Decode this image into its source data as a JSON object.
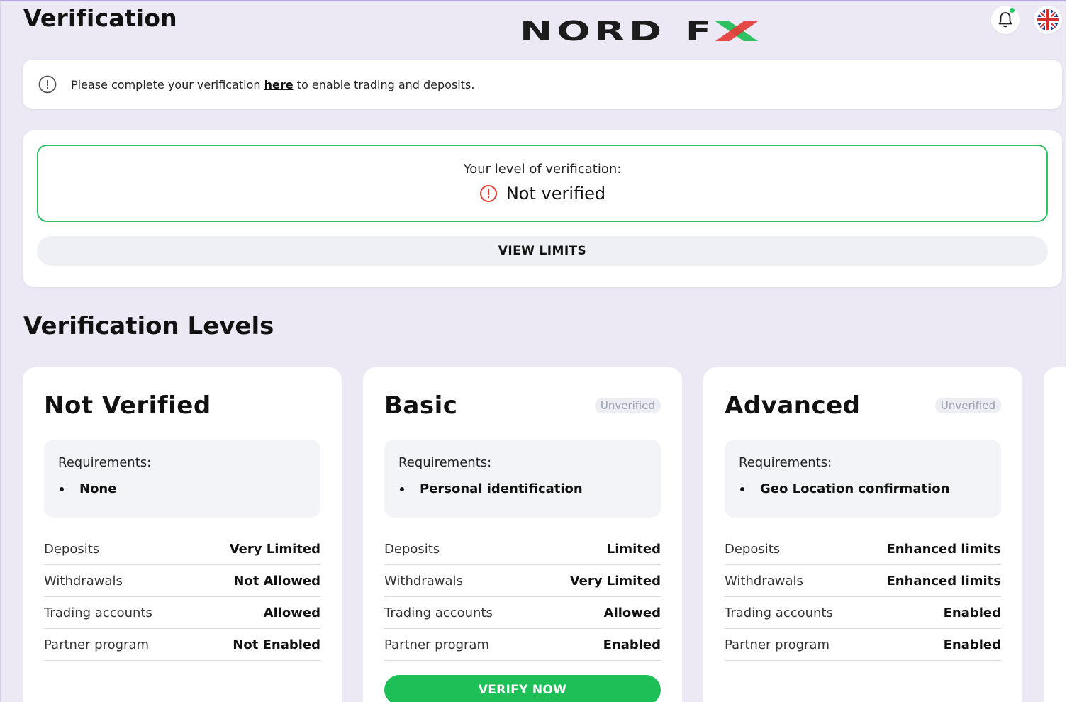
{
  "header": {
    "title": "Verification",
    "logo_text_1": "NORD",
    "logo_text_2": "FX"
  },
  "notice": {
    "before": "Please complete your verification ",
    "link": "here",
    "after": " to enable trading and deposits."
  },
  "current_level": {
    "label": "Your level of verification:",
    "status": "Not verified",
    "button": "VIEW LIMITS"
  },
  "levels_section": {
    "title": "Verification Levels"
  },
  "tiers": [
    {
      "name": "Not Verified",
      "badge": "",
      "requirements_title": "Requirements:",
      "requirement": "None",
      "rows": [
        {
          "label": "Deposits",
          "value": "Very Limited"
        },
        {
          "label": "Withdrawals",
          "value": "Not Allowed"
        },
        {
          "label": "Trading accounts",
          "value": "Allowed"
        },
        {
          "label": "Partner program",
          "value": "Not Enabled"
        }
      ]
    },
    {
      "name": "Basic",
      "badge": "Unverified",
      "requirements_title": "Requirements:",
      "requirement": "Personal identification",
      "rows": [
        {
          "label": "Deposits",
          "value": "Limited"
        },
        {
          "label": "Withdrawals",
          "value": "Very Limited"
        },
        {
          "label": "Trading accounts",
          "value": "Allowed"
        },
        {
          "label": "Partner program",
          "value": "Enabled"
        }
      ],
      "button": "VERIFY NOW"
    },
    {
      "name": "Advanced",
      "badge": "Unverified",
      "requirements_title": "Requirements:",
      "requirement": "Geo Location confirmation",
      "rows": [
        {
          "label": "Deposits",
          "value": "Enhanced limits"
        },
        {
          "label": "Withdrawals",
          "value": "Enhanced limits"
        },
        {
          "label": "Trading accounts",
          "value": "Enabled"
        },
        {
          "label": "Partner program",
          "value": "Enabled"
        }
      ]
    }
  ],
  "colors": {
    "accent_green": "#1fbf57",
    "error_red": "#e53935",
    "page_bg": "#ece9f5"
  },
  "icons": {
    "notice": "info-circle-icon",
    "status": "alert-circle-icon",
    "notifications": "bell-icon",
    "language": "uk-flag-icon"
  }
}
